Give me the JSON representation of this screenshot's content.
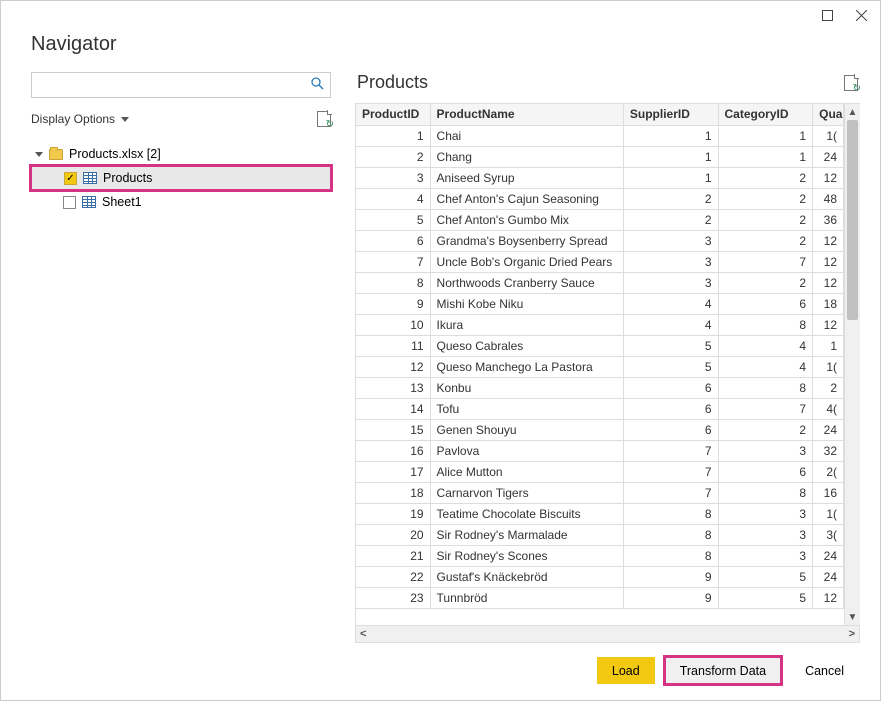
{
  "window": {
    "title": "Navigator"
  },
  "left": {
    "search_placeholder": "",
    "display_options_label": "Display Options",
    "root_label": "Products.xlsx [2]",
    "items": [
      {
        "label": "Products",
        "checked": true,
        "selected": true
      },
      {
        "label": "Sheet1",
        "checked": false,
        "selected": false
      }
    ]
  },
  "preview": {
    "title": "Products",
    "columns": [
      "ProductID",
      "ProductName",
      "SupplierID",
      "CategoryID",
      "Quan"
    ],
    "col_display": {
      "4": "Quan"
    },
    "rows": [
      {
        "id": 1,
        "name": "Chai",
        "sup": 1,
        "cat": 1,
        "q": "1("
      },
      {
        "id": 2,
        "name": "Chang",
        "sup": 1,
        "cat": 1,
        "q": "24"
      },
      {
        "id": 3,
        "name": "Aniseed Syrup",
        "sup": 1,
        "cat": 2,
        "q": "12"
      },
      {
        "id": 4,
        "name": "Chef Anton's Cajun Seasoning",
        "sup": 2,
        "cat": 2,
        "q": "48"
      },
      {
        "id": 5,
        "name": "Chef Anton's Gumbo Mix",
        "sup": 2,
        "cat": 2,
        "q": "36"
      },
      {
        "id": 6,
        "name": "Grandma's Boysenberry Spread",
        "sup": 3,
        "cat": 2,
        "q": "12"
      },
      {
        "id": 7,
        "name": "Uncle Bob's Organic Dried Pears",
        "sup": 3,
        "cat": 7,
        "q": "12"
      },
      {
        "id": 8,
        "name": "Northwoods Cranberry Sauce",
        "sup": 3,
        "cat": 2,
        "q": "12"
      },
      {
        "id": 9,
        "name": "Mishi Kobe Niku",
        "sup": 4,
        "cat": 6,
        "q": "18"
      },
      {
        "id": 10,
        "name": "Ikura",
        "sup": 4,
        "cat": 8,
        "q": "12"
      },
      {
        "id": 11,
        "name": "Queso Cabrales",
        "sup": 5,
        "cat": 4,
        "q": "1"
      },
      {
        "id": 12,
        "name": "Queso Manchego La Pastora",
        "sup": 5,
        "cat": 4,
        "q": "1("
      },
      {
        "id": 13,
        "name": "Konbu",
        "sup": 6,
        "cat": 8,
        "q": "2"
      },
      {
        "id": 14,
        "name": "Tofu",
        "sup": 6,
        "cat": 7,
        "q": "4("
      },
      {
        "id": 15,
        "name": "Genen Shouyu",
        "sup": 6,
        "cat": 2,
        "q": "24"
      },
      {
        "id": 16,
        "name": "Pavlova",
        "sup": 7,
        "cat": 3,
        "q": "32"
      },
      {
        "id": 17,
        "name": "Alice Mutton",
        "sup": 7,
        "cat": 6,
        "q": "2("
      },
      {
        "id": 18,
        "name": "Carnarvon Tigers",
        "sup": 7,
        "cat": 8,
        "q": "16"
      },
      {
        "id": 19,
        "name": "Teatime Chocolate Biscuits",
        "sup": 8,
        "cat": 3,
        "q": "1("
      },
      {
        "id": 20,
        "name": "Sir Rodney's Marmalade",
        "sup": 8,
        "cat": 3,
        "q": "3("
      },
      {
        "id": 21,
        "name": "Sir Rodney's Scones",
        "sup": 8,
        "cat": 3,
        "q": "24"
      },
      {
        "id": 22,
        "name": "Gustaf's Knäckebröd",
        "sup": 9,
        "cat": 5,
        "q": "24"
      },
      {
        "id": 23,
        "name": "Tunnbröd",
        "sup": 9,
        "cat": 5,
        "q": "12"
      }
    ]
  },
  "footer": {
    "load": "Load",
    "transform": "Transform Data",
    "cancel": "Cancel"
  }
}
